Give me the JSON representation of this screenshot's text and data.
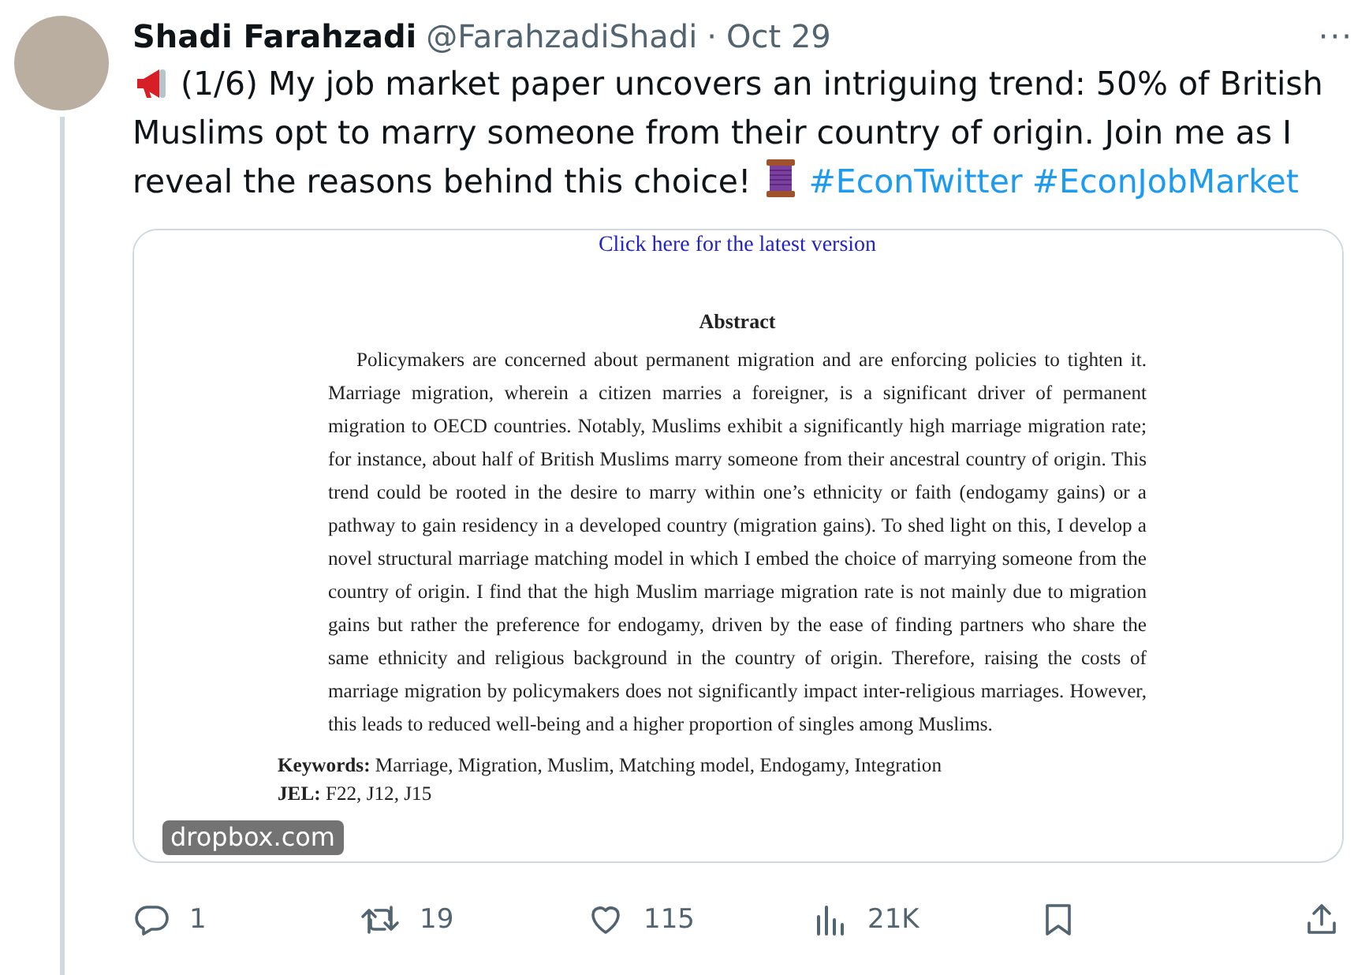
{
  "tweet": {
    "name": "Shadi Farahzadi",
    "handle": "@FarahzadiShadi",
    "separator": "·",
    "date": "Oct 29",
    "more": "···",
    "text_parts": [
      {
        "kind": "megaphone"
      },
      {
        "kind": "text",
        "text": " (1/6) My job market paper uncovers an intriguing trend: 50% of British Muslims opt to marry someone from their country of origin. Join me as I reveal the reasons behind this choice! "
      },
      {
        "kind": "thread"
      },
      {
        "kind": "hashtag",
        "text": "#EconTwitter"
      },
      {
        "kind": "hashtag",
        "text": "#EconJobMarket"
      }
    ]
  },
  "card": {
    "document": {
      "link": "Click here for the latest version",
      "heading": "Abstract",
      "abstract": "Policymakers are concerned about permanent migration and are enforcing policies to tighten it. Marriage migration, wherein a citizen marries a foreigner, is a significant driver of permanent migration to OECD countries. Notably, Muslims exhibit a significantly high marriage migration rate; for instance, about half of British Muslims marry someone from their ancestral country of origin. This trend could be rooted in the desire to marry within one’s ethnicity or faith (endogamy gains) or a pathway to gain residency in a developed country (migration gains). To shed light on this, I develop a novel structural marriage matching model in which I embed the choice of marrying someone from the country of origin. I find that the high Muslim marriage migration rate is not mainly due to migration gains but rather the preference for endogamy, driven by the ease of finding partners who share the same ethnicity and religious background in the country of origin. Therefore, raising the costs of marriage migration by policymakers does not significantly impact inter-religious marriages. However, this leads to reduced well-being and a higher proportion of singles among Muslims.",
      "keywords": "**Keywords:** Marriage, Migration, Muslim, Matching model, Endogamy, Integration",
      "jel": "**JEL:** F22, J12, J15"
    },
    "domain": "dropbox.com"
  },
  "actions": [
    {
      "kind": "reply",
      "count": "1"
    },
    {
      "kind": "retweet",
      "count": "19"
    },
    {
      "kind": "like",
      "count": "115"
    },
    {
      "kind": "views",
      "count": "21K"
    },
    {
      "kind": "bookmark"
    },
    {
      "kind": "share"
    }
  ]
}
